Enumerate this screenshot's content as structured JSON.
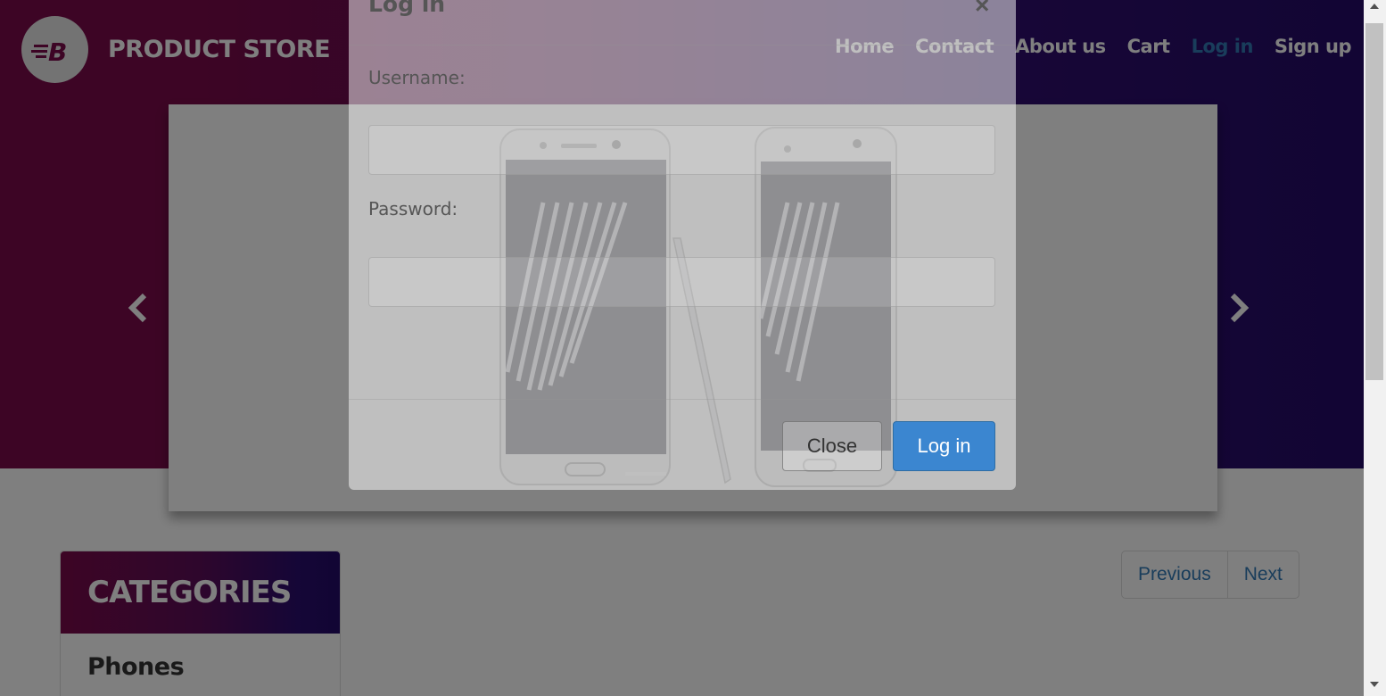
{
  "navbar": {
    "brand": "PRODUCT STORE",
    "links": [
      "Home",
      "Contact",
      "About us",
      "Cart",
      "Log in",
      "Sign up"
    ],
    "active_link": "Log in"
  },
  "categories": {
    "title": "CATEGORIES",
    "items": [
      "Phones"
    ]
  },
  "pager": {
    "previous": "Previous",
    "next": "Next"
  },
  "modal": {
    "title": "Log in",
    "username_label": "Username:",
    "username_value": "",
    "password_label": "Password:",
    "password_value": "",
    "close_label": "Close",
    "login_label": "Log in"
  },
  "colors": {
    "hero_left": "#7a0b4a",
    "hero_right": "#240b68",
    "accent": "#337ab7",
    "login_button": "#3b86d0"
  },
  "icons": {
    "brand": "brand-b-logo",
    "carousel_prev": "chevron-left",
    "carousel_next": "chevron-right",
    "modal_close": "close-x"
  }
}
